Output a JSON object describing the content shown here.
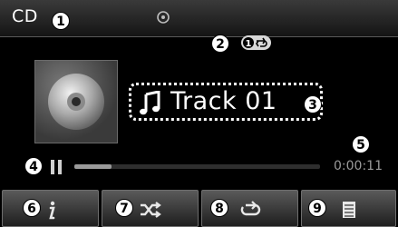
{
  "header": {
    "source_label": "CD",
    "source_icon": "disc-icon"
  },
  "repeat_indicator": {
    "icon": "repeat-one-icon"
  },
  "album_art": {
    "icon": "cd-disc-icon"
  },
  "track": {
    "title": "Track 01",
    "icon": "music-note-icon"
  },
  "playback": {
    "state": "paused",
    "elapsed": "0:00:11",
    "progress": 0.15
  },
  "soft_keys": [
    {
      "icon": "info-icon"
    },
    {
      "icon": "shuffle-icon"
    },
    {
      "icon": "repeat-icon"
    },
    {
      "icon": "list-icon"
    }
  ],
  "callouts": [
    "1",
    "2",
    "3",
    "4",
    "5",
    "6",
    "7",
    "8",
    "9"
  ],
  "colors": {
    "background": "#000000",
    "text": "#ffffff",
    "muted": "#9a9a9a"
  }
}
